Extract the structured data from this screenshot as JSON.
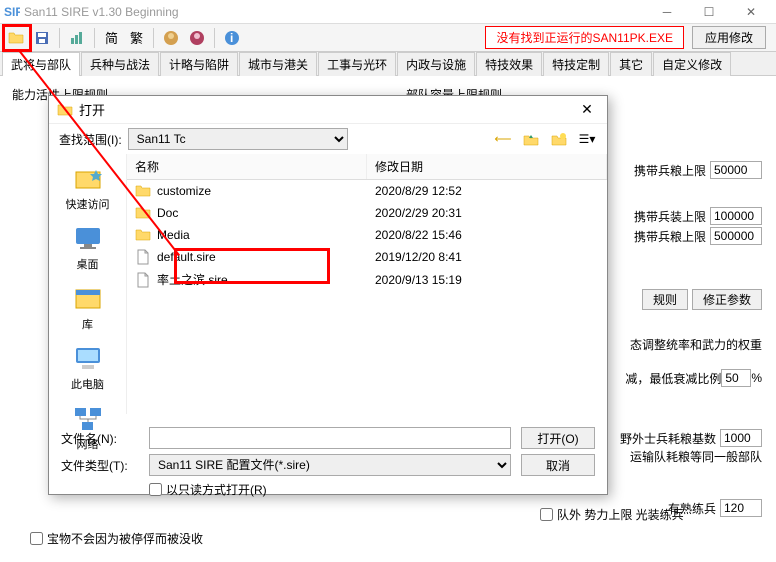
{
  "window": {
    "title": "San11 SIRE v1.30 Beginning",
    "status_warning": "没有找到正运行的SAN11PK.EXE",
    "apply_button": "应用修改"
  },
  "toolbar": {
    "simp": "简",
    "trad": "繁"
  },
  "tabs": [
    "武将与部队",
    "兵种与战法",
    "计略与陷阱",
    "城市与港关",
    "工事与光环",
    "内政与设施",
    "特技效果",
    "特技定制",
    "其它",
    "自定义修改"
  ],
  "panel_left": {
    "group1": "能力活性上限规则",
    "group_right": "部队容量上限规则",
    "bottom_text": "宝物不会因为被停俘而被没收",
    "chk_label": "队外 势力上限 光装练兵",
    "trained": "有熟练兵"
  },
  "right_fields": {
    "carry_food_limit_label": "携带兵粮上限",
    "carry_food_limit": "50000",
    "carry_armor_limit_label": "携带兵装上限",
    "carry_armor_limit": "100000",
    "carry_food_limit2_label": "携带兵粮上限",
    "carry_food_limit2": "500000",
    "rule_btn": "规则",
    "fix_btn": "修正参数",
    "weight_text": "态调整统率和武力的权重",
    "decay_text": "减，最低衰减比例",
    "decay_val": "50",
    "pct": "%",
    "outland_label": "野外士兵耗粮基数",
    "outland_val": "1000",
    "transport_text": "运输队耗粮等同一般部队",
    "trained_val": "120"
  },
  "dialog": {
    "title": "打开",
    "lookin_label": "查找范围(I):",
    "lookin_value": "San11 Tc",
    "places": [
      {
        "label": "快速访问",
        "icon": "star"
      },
      {
        "label": "桌面",
        "icon": "desktop"
      },
      {
        "label": "库",
        "icon": "library"
      },
      {
        "label": "此电脑",
        "icon": "pc"
      },
      {
        "label": "网络",
        "icon": "network"
      }
    ],
    "columns": {
      "name": "名称",
      "date": "修改日期"
    },
    "files": [
      {
        "name": "customize",
        "date": "2020/8/29 12:52",
        "type": "folder"
      },
      {
        "name": "Doc",
        "date": "2020/2/29 20:31",
        "type": "folder"
      },
      {
        "name": "Media",
        "date": "2020/8/22 15:46",
        "type": "folder"
      },
      {
        "name": "default.sire",
        "date": "2019/12/20 8:41",
        "type": "file"
      },
      {
        "name": "率土之滨.sire",
        "date": "2020/9/13 15:19",
        "type": "file"
      }
    ],
    "filename_label": "文件名(N):",
    "filename_value": "",
    "filetype_label": "文件类型(T):",
    "filetype_value": "San11 SIRE 配置文件(*.sire)",
    "open_btn": "打开(O)",
    "cancel_btn": "取消",
    "readonly_label": "以只读方式打开(R)"
  }
}
